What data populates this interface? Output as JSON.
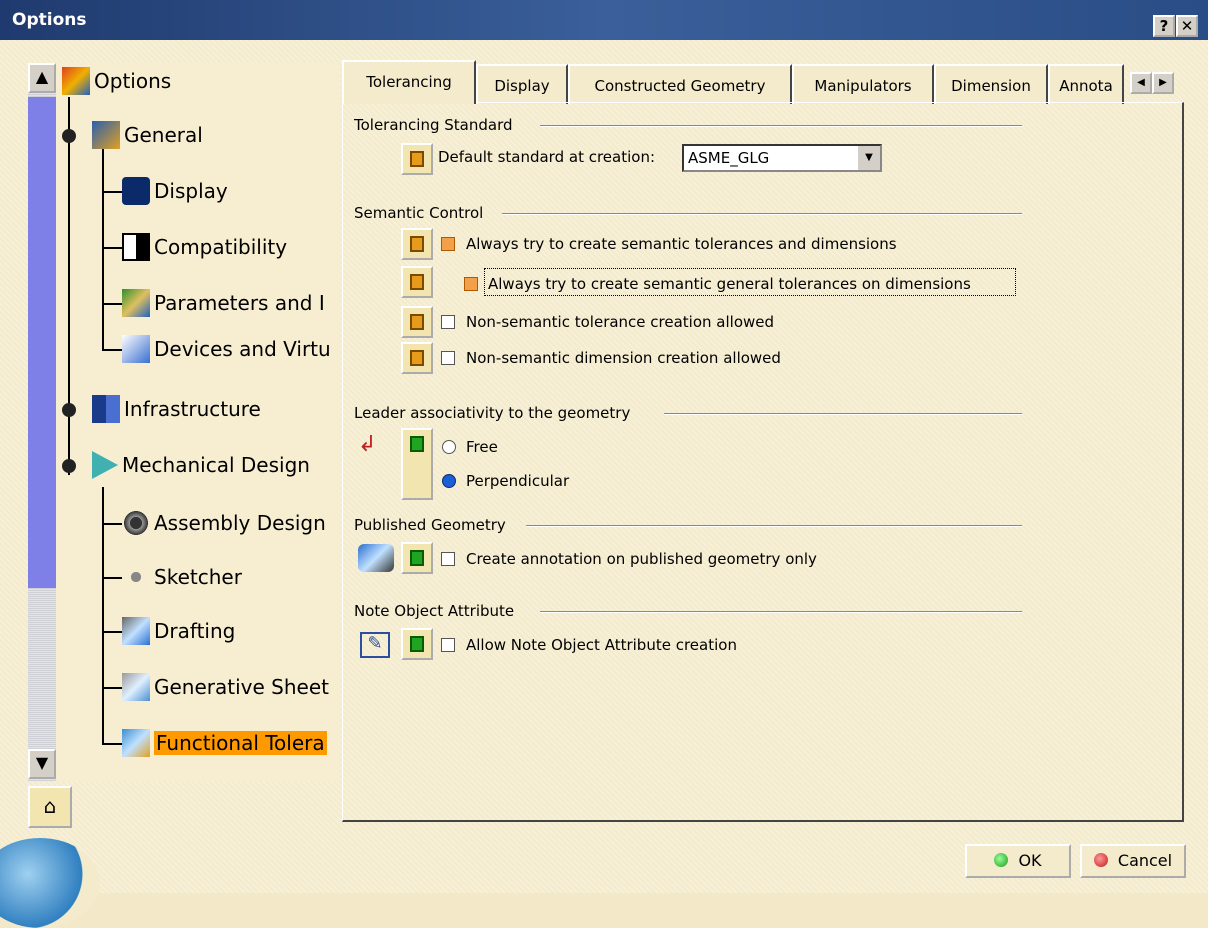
{
  "window": {
    "title": "Options",
    "help_label": "?",
    "close_label": "✕"
  },
  "tree": {
    "items": [
      {
        "label": "Options",
        "icon": "options-icon"
      },
      {
        "label": "General",
        "icon": "general-icon"
      },
      {
        "label": "Display",
        "icon": "display-icon"
      },
      {
        "label": "Compatibility",
        "icon": "compatibility-icon"
      },
      {
        "label": "Parameters and I",
        "icon": "parameters-icon"
      },
      {
        "label": "Devices and Virtu",
        "icon": "devices-icon"
      },
      {
        "label": "Infrastructure",
        "icon": "infrastructure-icon"
      },
      {
        "label": "Mechanical Design",
        "icon": "mechanical-icon"
      },
      {
        "label": "Assembly Design",
        "icon": "assembly-icon"
      },
      {
        "label": "Sketcher",
        "icon": "sketcher-icon"
      },
      {
        "label": "Drafting",
        "icon": "drafting-icon"
      },
      {
        "label": "Generative Sheet",
        "icon": "sheet-icon"
      },
      {
        "label": "Functional Tolera",
        "icon": "functional-tolerancing-icon"
      }
    ],
    "selected": "Functional Tolera"
  },
  "tabs": [
    "Tolerancing",
    "Display",
    "Constructed Geometry",
    "Manipulators",
    "Dimension",
    "Annota"
  ],
  "active_tab": "Tolerancing",
  "tolerancing_standard": {
    "title": "Tolerancing Standard",
    "default_label": "Default standard at creation:",
    "default_value": "ASME_GLG"
  },
  "semantic_control": {
    "title": "Semantic Control",
    "options": [
      {
        "label": "Always try to create semantic tolerances and dimensions",
        "checked": true
      },
      {
        "label": "Always try to create semantic general tolerances on dimensions",
        "checked": true
      },
      {
        "label": "Non-semantic tolerance creation allowed",
        "checked": false
      },
      {
        "label": "Non-semantic dimension creation allowed",
        "checked": false
      }
    ]
  },
  "leader": {
    "title": "Leader associativity to the geometry",
    "options": [
      {
        "label": "Free",
        "selected": false
      },
      {
        "label": "Perpendicular",
        "selected": true
      }
    ]
  },
  "published": {
    "title": "Published Geometry",
    "label": "Create annotation on published geometry only",
    "checked": false
  },
  "note": {
    "title": "Note Object Attribute",
    "label": "Allow Note Object Attribute creation",
    "checked": false
  },
  "buttons": {
    "ok": "OK",
    "cancel": "Cancel"
  },
  "colors": {
    "selection": "#ff9900",
    "titlebar": "#1f3a6e",
    "scroll_thumb": "#7f7fe8"
  }
}
